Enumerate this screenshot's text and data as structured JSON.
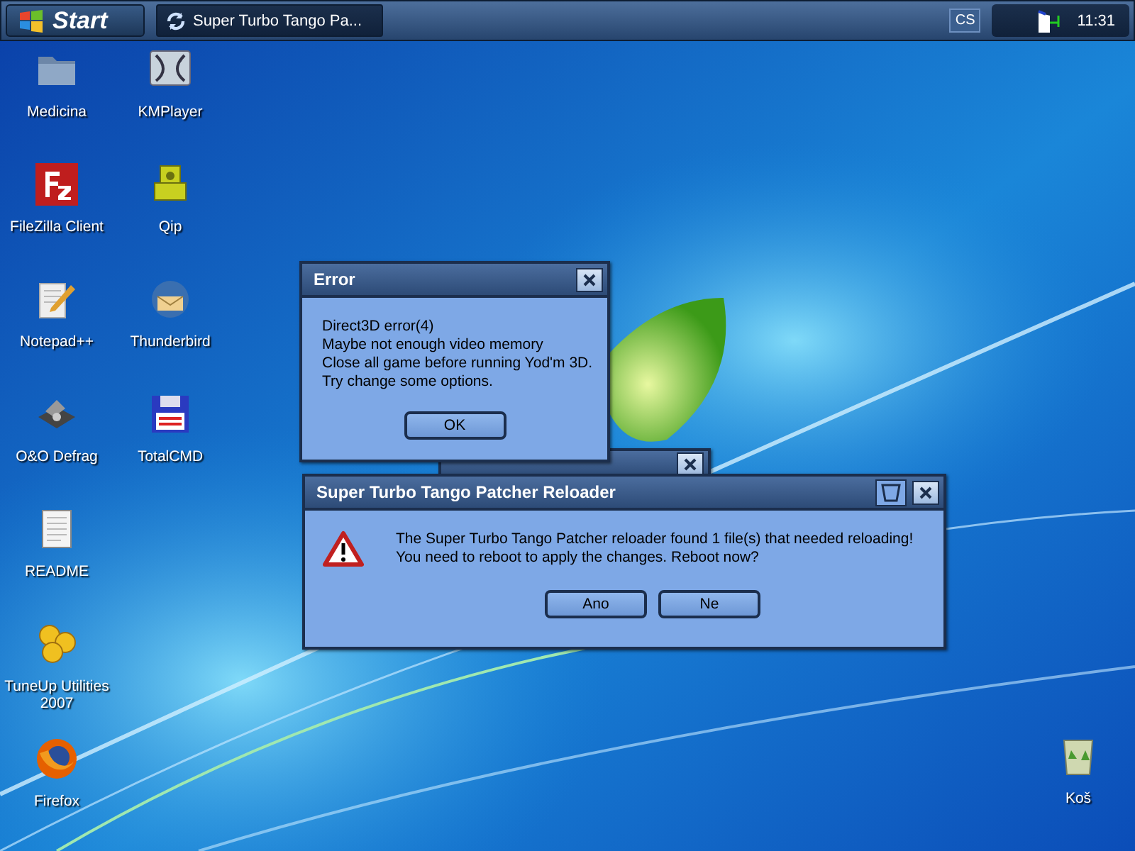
{
  "taskbar": {
    "start": "Start",
    "tasks": [
      {
        "label": "Super Turbo Tango Pa...",
        "selected": true
      }
    ],
    "language": "CS",
    "clock": "11:31"
  },
  "desktop": {
    "columns": [
      [
        {
          "label": "Medicina",
          "kind": "folder"
        },
        {
          "label": "FileZilla Client",
          "kind": "filezilla"
        },
        {
          "label": "Notepad++",
          "kind": "notepad"
        },
        {
          "label": "O&O Defrag",
          "kind": "defrag"
        },
        {
          "label": "README",
          "kind": "document"
        },
        {
          "label": "TuneUp Utilities 2007",
          "kind": "tuneup"
        },
        {
          "label": "Firefox",
          "kind": "firefox"
        }
      ],
      [
        {
          "label": "KMPlayer",
          "kind": "player"
        },
        {
          "label": "Qip",
          "kind": "qip"
        },
        {
          "label": "Thunderbird",
          "kind": "mail"
        },
        {
          "label": "TotalCMD",
          "kind": "floppy"
        }
      ]
    ],
    "recycle_bin": {
      "label": "Koš"
    }
  },
  "error_dialog": {
    "title": "Error",
    "lines": [
      "Direct3D error(4)",
      "Maybe not enough video memory",
      "Close all game before running Yod'm 3D.",
      "Try change some options."
    ],
    "buttons": [
      "OK"
    ]
  },
  "reloader_dialog": {
    "title": "Super Turbo Tango Patcher Reloader",
    "lines": [
      "The Super Turbo Tango Patcher reloader found 1 file(s) that needed reloading!",
      "You need to reboot to apply the changes. Reboot now?"
    ],
    "buttons": [
      "Ano",
      "Ne"
    ]
  }
}
